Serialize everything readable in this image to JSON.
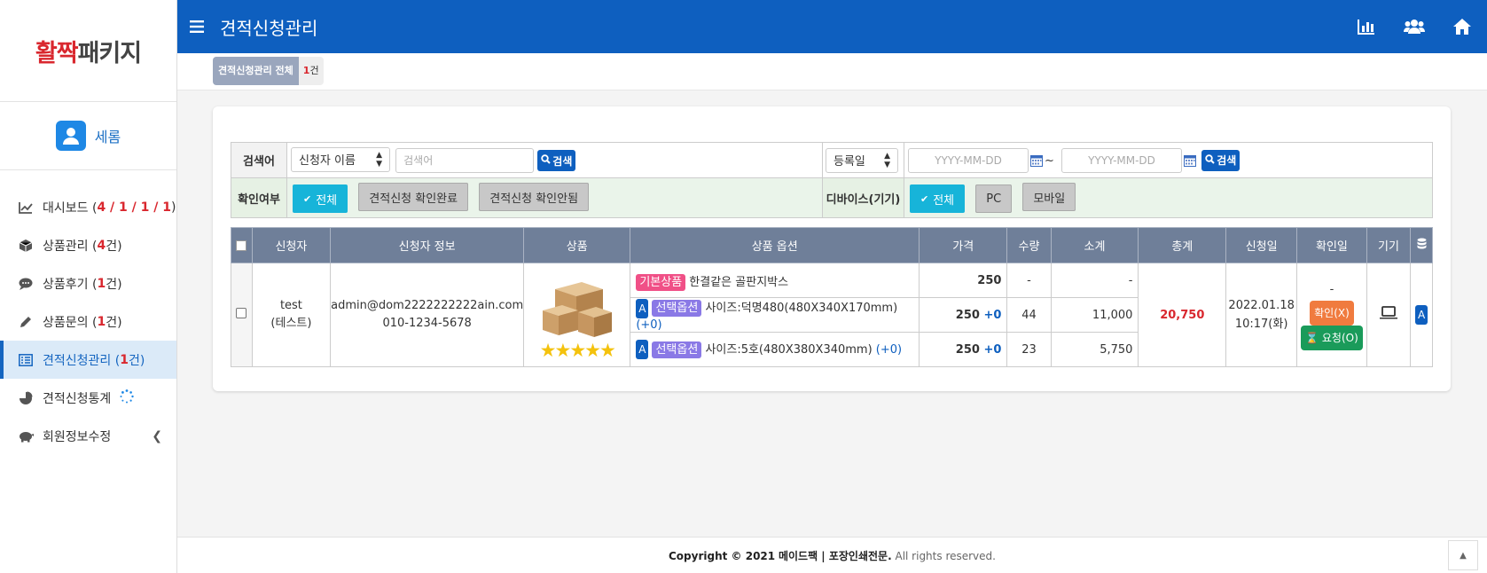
{
  "app": {
    "logo_part1": "활짝",
    "logo_part2": "패키지",
    "user_name": "세롬",
    "page_title": "견적신청관리"
  },
  "sidebar": {
    "items": [
      {
        "label": "대시보드 (",
        "counts": "4 / 1 / 1 / 1",
        "suffix": ")",
        "icon": "chart-line-icon"
      },
      {
        "label": "상품관리 (",
        "counts": "4",
        "suffix": "건)",
        "icon": "box-icon"
      },
      {
        "label": "상품후기 (",
        "counts": "1",
        "suffix": "건)",
        "icon": "comment-icon"
      },
      {
        "label": "상품문의 (",
        "counts": "1",
        "suffix": "건)",
        "icon": "pencil-icon"
      },
      {
        "label": "견적신청관리 (",
        "counts": "1",
        "suffix": "건)",
        "icon": "list-icon"
      },
      {
        "label": "견적신청통계",
        "icon": "pie-chart-icon"
      },
      {
        "label": "회원정보수정",
        "icon": "piggy-bank-icon"
      }
    ]
  },
  "breadcrumb": {
    "label": "견적신청관리 전체",
    "count": "1",
    "unit": "건"
  },
  "search": {
    "keyword_label": "검색어",
    "field_select": "신청자 이름",
    "keyword_placeholder": "검색어",
    "search_btn": "검색",
    "date_select": "등록일",
    "date_from_placeholder": "YYYY-MM-DD",
    "date_to_placeholder": "YYYY-MM-DD",
    "tilde": "~",
    "confirm_label": "확인여부",
    "confirm_all": "전체",
    "confirm_done": "견적신청 확인완료",
    "confirm_not": "견적신청 확인안됨",
    "device_label": "디바이스(기기)",
    "device_all": "전체",
    "device_pc": "PC",
    "device_mobile": "모바일"
  },
  "table": {
    "headers": [
      "신청자",
      "신청자 정보",
      "상품",
      "상품 옵션",
      "가격",
      "수량",
      "소계",
      "총계",
      "신청일",
      "확인일",
      "기기"
    ],
    "row": {
      "applicant_id": "test",
      "applicant_name": "(테스트)",
      "email": "admin@dom2222222222ain.com",
      "phone": "010-1234-5678",
      "rating": 5,
      "options": [
        {
          "badge_prefix": "",
          "badge": "기본상품",
          "name": "한결같은 골판지박스",
          "price": "250",
          "plus": "",
          "qty": "-",
          "subtotal": "-"
        },
        {
          "badge_prefix": "A",
          "badge": "선택옵션",
          "name": "사이즈:덕명480(480X340X170mm)",
          "extra": "(+0)",
          "price": "250",
          "plus": "+0",
          "qty": "44",
          "subtotal": "11,000"
        },
        {
          "badge_prefix": "A",
          "badge": "선택옵션",
          "name": "사이즈:5호(480X380X340mm)",
          "extra": "(+0)",
          "price": "250",
          "plus": "+0",
          "qty": "23",
          "subtotal": "5,750"
        }
      ],
      "total": "20,750",
      "date": "2022.01.18",
      "time": "10:17(화)",
      "confirm_dash": "-",
      "confirm_btn": "확인(X)",
      "request_btn": "요청(O)",
      "device": "laptop-icon",
      "end_badge": "A"
    }
  },
  "footer": {
    "prefix": "Copyright © 2021",
    "brand": "메이드팩 | 포장인쇄전문.",
    "suffix": "All rights reserved."
  },
  "colors": {
    "primary": "#0e5fbf",
    "header_row": "#6f7f99",
    "accent_red": "#d9272e",
    "cyan_toggle": "#17b4d9",
    "filter_row_bg": "#eaf4ea"
  }
}
